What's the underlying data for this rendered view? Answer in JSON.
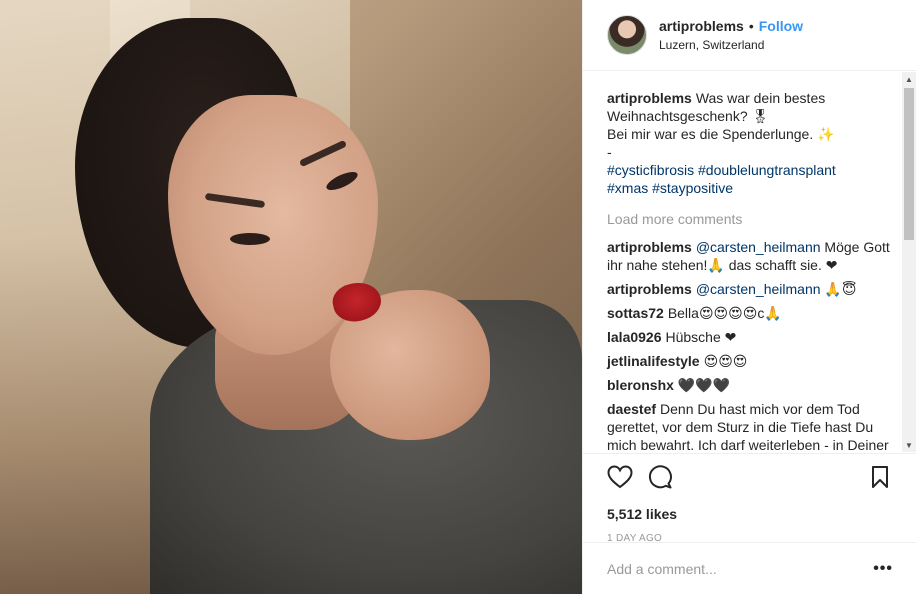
{
  "post": {
    "username": "artiproblems",
    "dot": "•",
    "follow_label": "Follow",
    "location": "Luzern, Switzerland",
    "photo_alt": "Photo of a young woman with red lipstick resting chin on hand",
    "caption": {
      "username": "artiproblems",
      "line1": "Was war dein bestes Weihnachtsgeschenk? 🎖",
      "line2": "Bei mir war es die Spenderlunge. ✨",
      "dash": "-",
      "tags1": "#cysticfibrosis #doublelungtransplant",
      "tags2": "#xmas #staypositive"
    },
    "load_more": "Load more comments",
    "comments": [
      {
        "user": "artiproblems",
        "mention": "@carsten_heilmann",
        "text": " Möge Gott ihr nahe stehen!🙏 das schafft sie. ❤"
      },
      {
        "user": "artiproblems",
        "mention": "@carsten_heilmann",
        "text": " 🙏😇"
      },
      {
        "user": "sottas72",
        "mention": "",
        "text": "Bella😍😍😍😍c🙏"
      },
      {
        "user": "lala0926",
        "mention": "",
        "text": "Hübsche ❤"
      },
      {
        "user": "jetlinalifestyle",
        "mention": "",
        "text": "😍😍😍"
      },
      {
        "user": "bleronshx",
        "mention": "",
        "text": "🖤🖤🖤"
      },
      {
        "user": "daestef",
        "mention": "",
        "text": "Denn Du hast mich vor dem Tod gerettet, vor dem Sturz in die Tiefe hast Du mich bewahrt. Ich darf weiterleben - in Deiner Nähe. Du hast mir das Leben neu"
      }
    ],
    "likes": "5,512 likes",
    "time": "1 DAY AGO",
    "add_comment_placeholder": "Add a comment...",
    "more_label": "•••"
  },
  "icons": {
    "like": "heart-icon",
    "comment": "comment-bubble-icon",
    "save": "bookmark-icon"
  },
  "colors": {
    "link": "#3897f0",
    "hashtag": "#003569",
    "muted": "#999999",
    "text": "#262626"
  }
}
